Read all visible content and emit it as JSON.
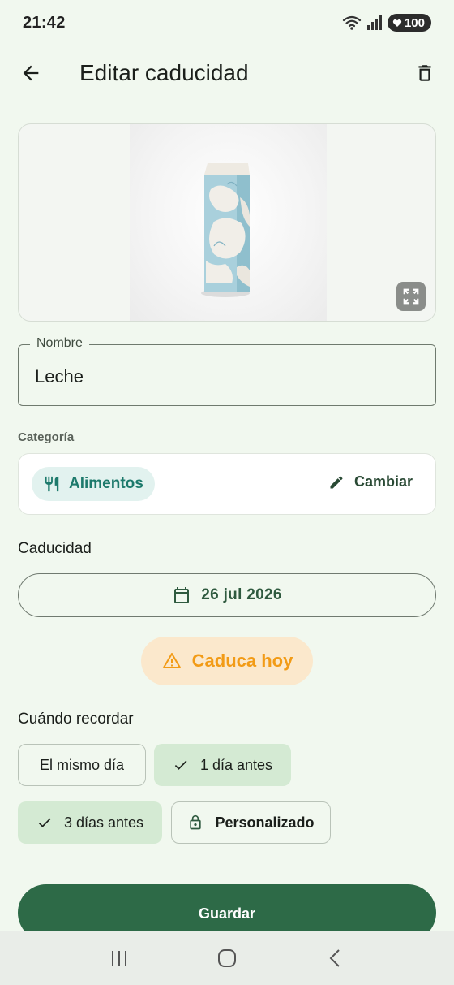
{
  "status": {
    "time": "21:42",
    "battery": "100"
  },
  "header": {
    "title": "Editar caducidad",
    "back_icon": "arrow-back-icon",
    "delete_icon": "trash-icon"
  },
  "product": {
    "image_alt": "milk-carton-photo",
    "expand_icon": "fullscreen-icon"
  },
  "name_field": {
    "label": "Nombre",
    "value": "Leche"
  },
  "category": {
    "section_label": "Categoría",
    "selected": "Alimentos",
    "selected_icon": "utensils-icon",
    "change_label": "Cambiar",
    "change_icon": "pencil-icon"
  },
  "expiry": {
    "section_label": "Caducidad",
    "date": "26 jul 2026",
    "date_icon": "calendar-icon",
    "status": "Caduca hoy",
    "status_icon": "warning-icon"
  },
  "reminders": {
    "section_label": "Cuándo recordar",
    "options": [
      {
        "label": "El mismo día",
        "selected": false
      },
      {
        "label": "1 día antes",
        "selected": true
      },
      {
        "label": "3 días antes",
        "selected": true
      },
      {
        "label": "Personalizado",
        "selected": false,
        "icon": "lock-icon"
      }
    ]
  },
  "actions": {
    "save_label": "Guardar"
  },
  "colors": {
    "background": "#f1f8ef",
    "primary": "#2d6a47",
    "warning": "#f29b16",
    "category_accent": "#1d7a6c"
  }
}
